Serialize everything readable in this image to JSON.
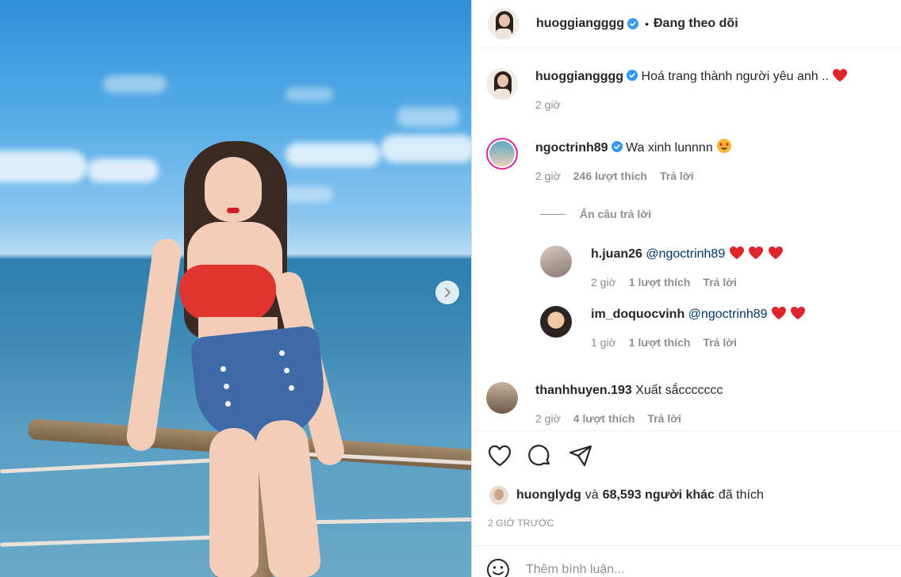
{
  "post": {
    "image_alt": "Photo of a woman in a red bikini top and blue high-waisted bottoms at the seaside",
    "next_icon": "chevron-right-icon"
  },
  "header": {
    "username": "huoggiangggg",
    "verified_icon": "verified-badge-icon",
    "separator": "•",
    "follow_status": "Đang theo dõi"
  },
  "caption": {
    "username": "huoggiangggg",
    "text": "Hoá trang thành người yêu anh ..",
    "emoji": "red-heart-icon",
    "time": "2 giờ"
  },
  "comments": [
    {
      "username": "ngoctrinh89",
      "text": "Wa xinh lunnnn",
      "emoji": "heart-eyes-icon",
      "time": "2 giờ",
      "likes": "246 lượt thích",
      "reply": "Trả lời"
    }
  ],
  "hide_replies_label": "Ẩn câu trả lời",
  "replies": [
    {
      "username": "h.juan26",
      "mention": "@ngoctrinh89",
      "hearts": 3,
      "time": "2 giờ",
      "likes": "1 lượt thích",
      "reply": "Trả lời"
    },
    {
      "username": "im_doquocvinh",
      "mention": "@ngoctrinh89",
      "hearts": 2,
      "time": "1 giờ",
      "likes": "1 lượt thích",
      "reply": "Trả lời"
    }
  ],
  "comment2": {
    "username": "thanhhuyen.193",
    "text": "Xuất sắccccccc",
    "time": "2 giờ",
    "likes": "4 lượt thích",
    "reply": "Trả lời"
  },
  "actions": {
    "like_icon": "heart-outline-icon",
    "comment_icon": "comment-bubble-icon",
    "share_icon": "paper-plane-icon"
  },
  "likes_line": {
    "user": "huonglydg",
    "and": "và",
    "count": "68,593 người khác",
    "suffix": "đã thích"
  },
  "timestamp": "2 GIỜ TRƯỚC",
  "add_comment": {
    "placeholder": "Thêm bình luận...",
    "emoji_icon": "smiley-icon"
  },
  "colors": {
    "verified": "#3897f0",
    "heart": "#ed4956",
    "text_primary": "#262626",
    "text_secondary": "#8e8e8e",
    "mention": "#00376b"
  }
}
